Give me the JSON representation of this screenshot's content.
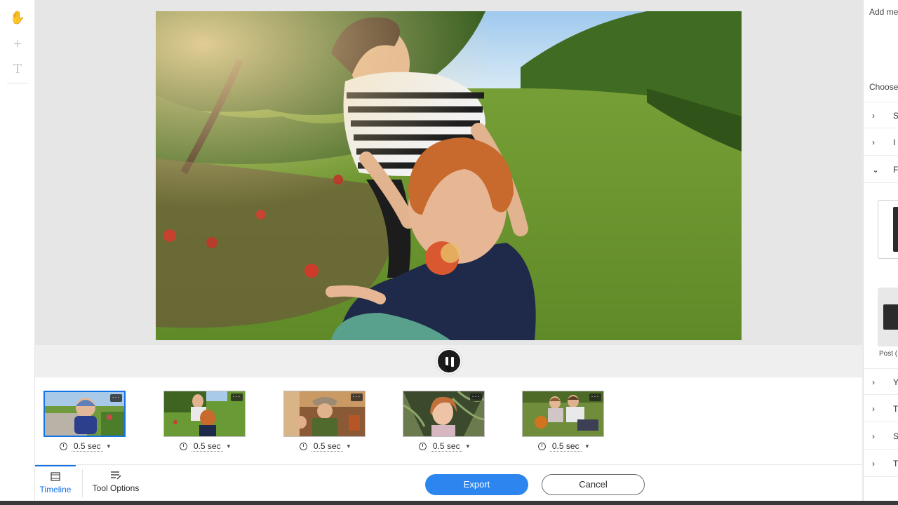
{
  "left_toolbar": {
    "tools": [
      {
        "icon": "hand-icon",
        "glyph": "✋"
      },
      {
        "icon": "plus-icon",
        "glyph": "+"
      },
      {
        "icon": "text-tool-icon",
        "glyph": "T"
      }
    ]
  },
  "playback": {
    "state": "playing",
    "icon": "pause-icon"
  },
  "timeline": {
    "clips": [
      {
        "duration": "0.5 sec",
        "selected": true
      },
      {
        "duration": "0.5 sec",
        "selected": false
      },
      {
        "duration": "0.5 sec",
        "selected": false
      },
      {
        "duration": "0.5 sec",
        "selected": false
      },
      {
        "duration": "0.5 sec",
        "selected": false
      }
    ],
    "more_glyph": "···"
  },
  "bottom_bar": {
    "tab_timeline": "Timeline",
    "tab_tool_options": "Tool Options",
    "export_label": "Export",
    "cancel_label": "Cancel"
  },
  "right_panel": {
    "add_text": "Add me",
    "choose_text": "Choose",
    "post_text": "Post (",
    "rows_top": [
      {
        "chevron": "›",
        "letter": "S"
      },
      {
        "chevron": "›",
        "letter": "I"
      },
      {
        "chevron": "⌄",
        "letter": "F"
      }
    ],
    "rows_bottom": [
      {
        "chevron": "›",
        "letter": "Y"
      },
      {
        "chevron": "›",
        "letter": "T"
      },
      {
        "chevron": "›",
        "letter": "S"
      },
      {
        "chevron": "›",
        "letter": "T"
      }
    ]
  },
  "colors": {
    "accent": "#1473e6",
    "export_bg": "#2d86ef",
    "canvas_bg": "#e6e6e6"
  }
}
